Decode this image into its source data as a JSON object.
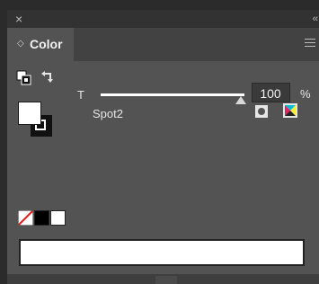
{
  "window": {
    "close_glyph": "×",
    "collapse_glyph": "‹‹"
  },
  "panel": {
    "tab_label": "Color",
    "tab_toggle_glyph": "◇"
  },
  "tint": {
    "label": "T",
    "value": "100",
    "unit": "%",
    "level_percent": 100
  },
  "swatch": {
    "name": "Spot2"
  },
  "colors": {
    "panel_bg": "#535353",
    "fill": "#ffffff",
    "stroke": "#111111",
    "none_slash": "#e02020"
  },
  "icons": {
    "default_fill_stroke": "default-fill-stroke-icon",
    "swap": "swap-fill-stroke-icon",
    "add_swatch": "add-swatch-icon",
    "spectrum": "spectrum-icon",
    "menu": "hamburger-menu-icon"
  }
}
